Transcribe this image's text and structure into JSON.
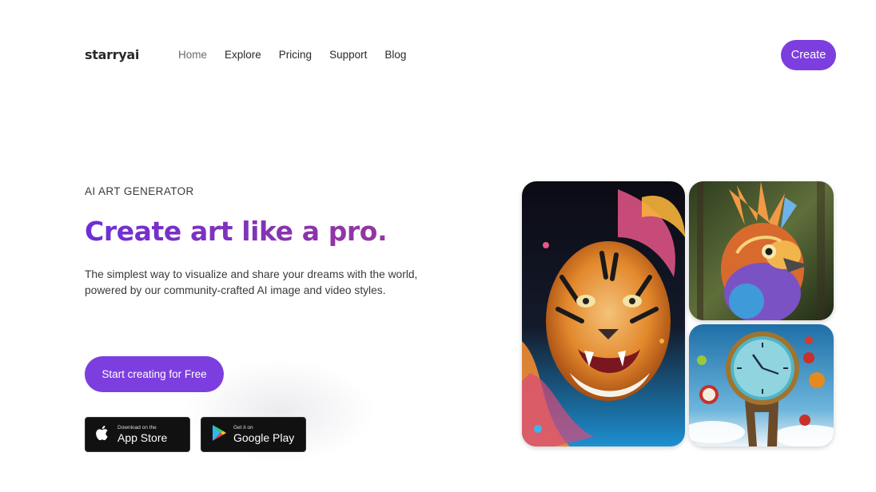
{
  "brand": {
    "name": "starryai"
  },
  "nav": {
    "items": [
      {
        "label": "Home"
      },
      {
        "label": "Explore"
      },
      {
        "label": "Pricing"
      },
      {
        "label": "Support"
      },
      {
        "label": "Blog"
      }
    ],
    "create_label": "Create"
  },
  "hero": {
    "eyebrow": "AI ART GENERATOR",
    "headline": "Create art like a pro.",
    "subtitle": "The simplest way to visualize and share your dreams with the world, powered by our community-crafted AI image and video styles.",
    "cta_label": "Start creating for Free"
  },
  "stores": {
    "apple": {
      "small": "Download on the",
      "big": "App Store"
    },
    "google": {
      "small": "Get it on",
      "big": "Google Play"
    }
  },
  "gallery": {
    "images": [
      {
        "icon": "tiger-artwork"
      },
      {
        "icon": "bird-artwork"
      },
      {
        "icon": "clock-artwork"
      }
    ]
  },
  "colors": {
    "accent": "#7d3ee0",
    "headline_from": "#6d2fd6",
    "headline_to": "#9b3a9b",
    "store_bg": "#111111"
  }
}
